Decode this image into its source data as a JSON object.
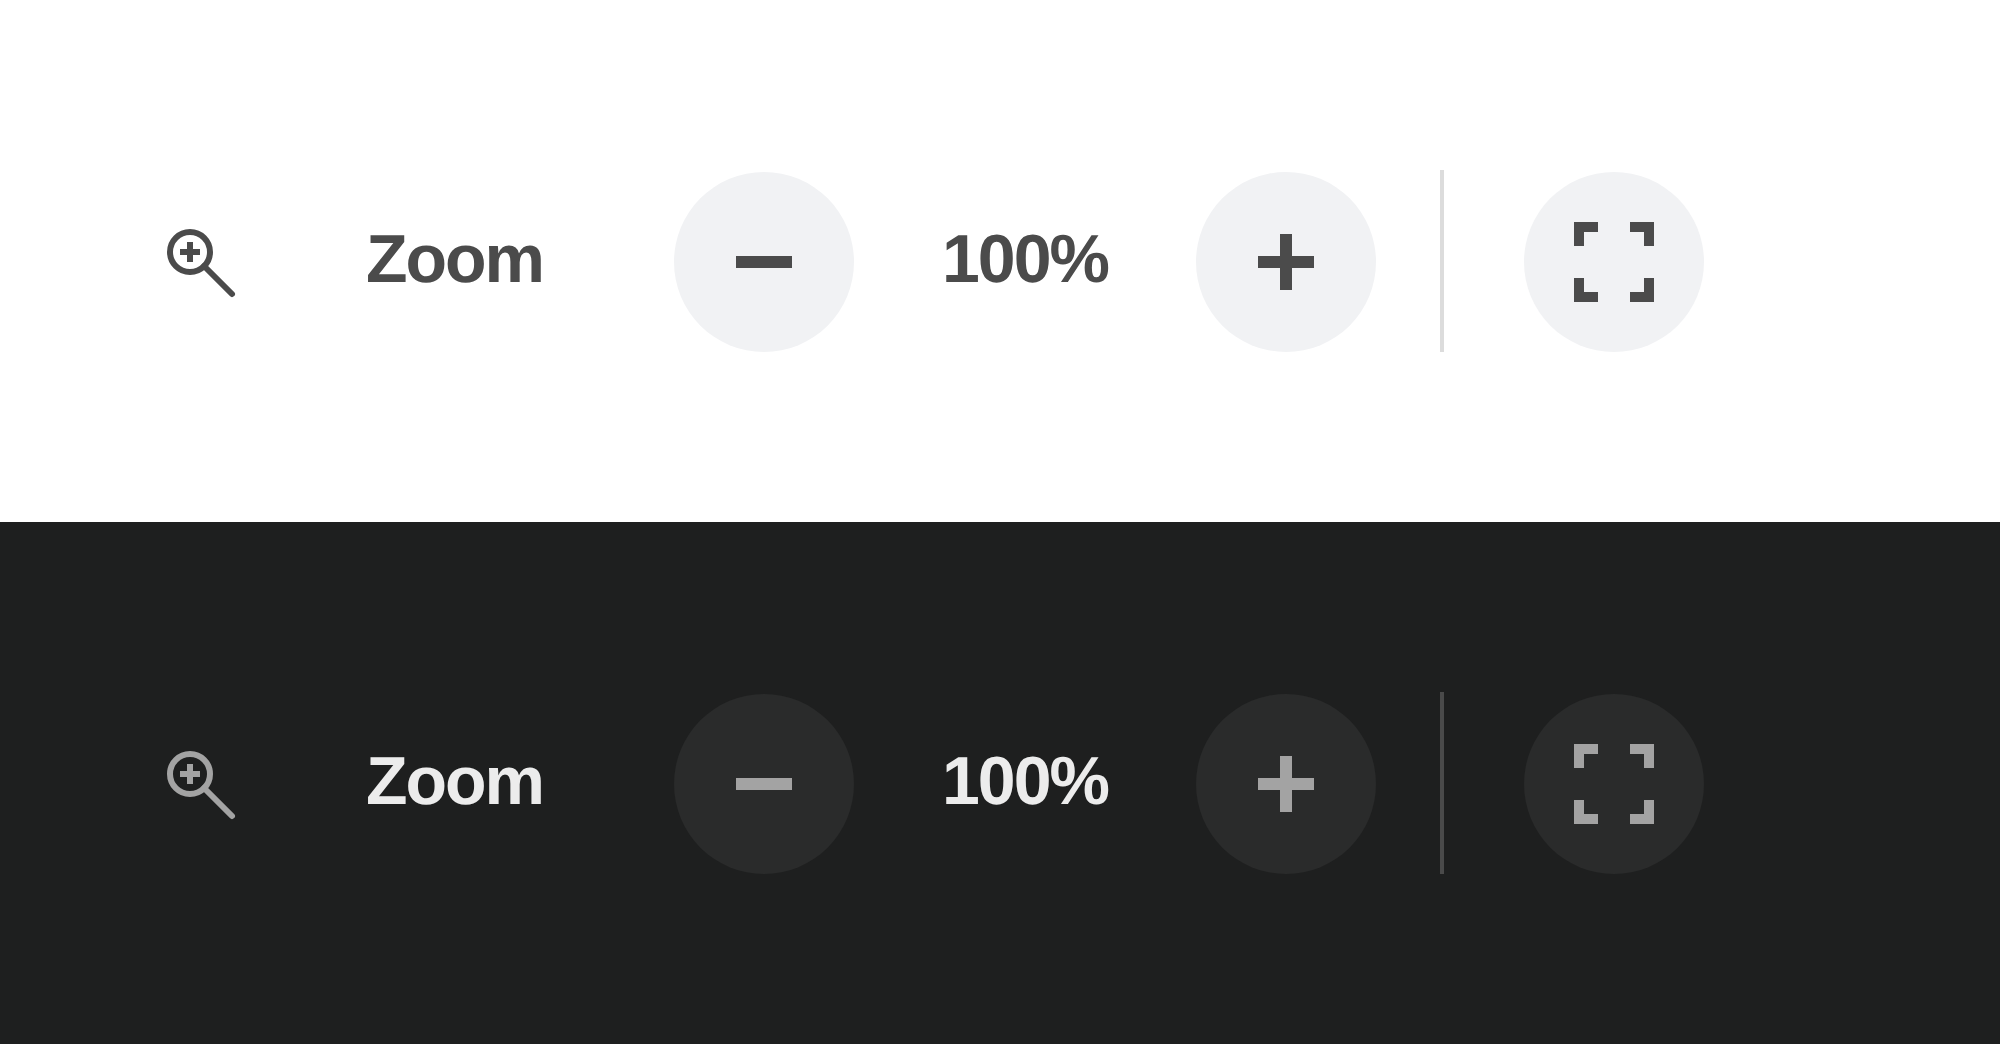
{
  "panels": [
    {
      "dark": false,
      "label": "Zoom",
      "value": "100%"
    },
    {
      "dark": true,
      "label": "Zoom",
      "value": "100%"
    }
  ]
}
